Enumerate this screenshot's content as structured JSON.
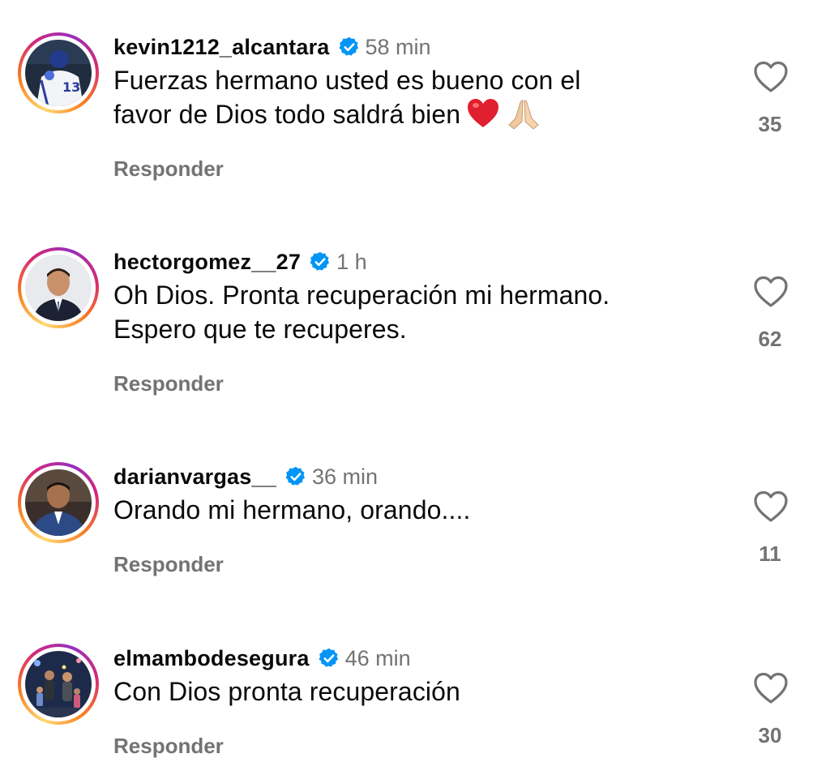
{
  "reply_label": "Responder",
  "colors": {
    "verified": "#0095f6",
    "muted": "#737373"
  },
  "comments": [
    {
      "username": "kevin1212_alcantara",
      "time": "58 min",
      "text_line1": "Fuerzas hermano usted es bueno con el",
      "text_line2": "favor de Dios todo saldrá bien",
      "emojis": [
        "red-heart",
        "folded-hands"
      ],
      "likes": "35",
      "avatar": "baseball-player-13"
    },
    {
      "username": "hectorgomez__27",
      "time": "1 h",
      "text_line1": "Oh Dios. Pronta recuperación mi hermano.",
      "text_line2": "Espero que te recuperes.",
      "likes": "62",
      "avatar": "man-in-suit"
    },
    {
      "username": "darianvargas__",
      "time": "36 min",
      "text_line1": "Orando mi hermano, orando....",
      "likes": "11",
      "avatar": "man-in-blue-suit"
    },
    {
      "username": "elmambodesegura",
      "time": "46 min",
      "text_line1": "Con Dios pronta recuperación",
      "likes": "30",
      "avatar": "family-photo"
    }
  ]
}
